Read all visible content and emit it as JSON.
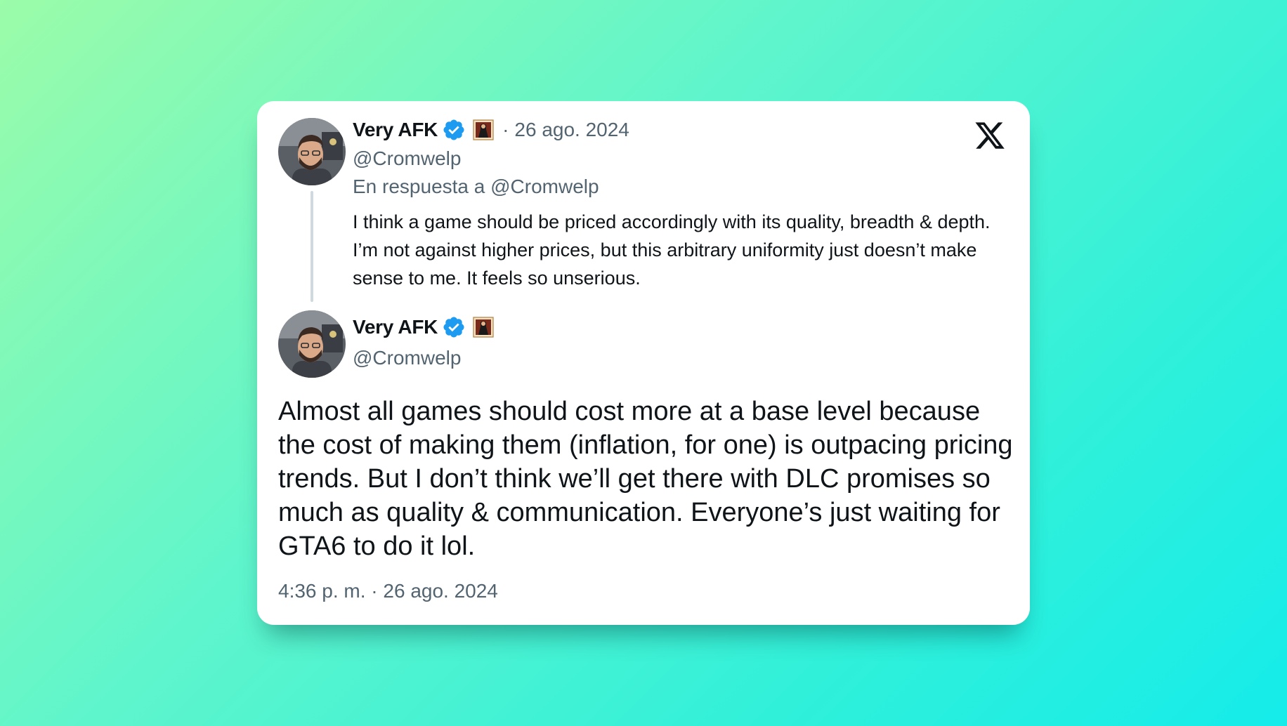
{
  "parent_tweet": {
    "display_name": "Very AFK",
    "handle": "@Cromwelp",
    "separator": "·",
    "date": "26 ago. 2024",
    "reply_context": "En respuesta a @Cromwelp",
    "text": "I think a game should be priced accordingly with its quality, breadth & depth. I’m not against higher prices, but this arbitrary uniformity just doesn’t make sense to me. It feels so unserious.",
    "verified": true,
    "avatar_icon": "avatar-photo-icon",
    "badge_icon": "affiliate-badge-icon"
  },
  "main_tweet": {
    "display_name": "Very AFK",
    "handle": "@Cromwelp",
    "text": "Almost all games should cost more at a base level because the cost of making them (inflation, for one) is outpacing pricing trends. But I don’t think we’ll get there with DLC promises so much as quality & communication. Everyone’s just waiting for GTA6 to do it lol.",
    "timestamp": "4:36 p. m. · 26 ago. 2024",
    "verified": true
  },
  "branding": {
    "logo_icon": "x-logo-icon"
  },
  "colors": {
    "text_primary": "#0f1419",
    "text_secondary": "#536471",
    "verified_blue": "#1d9bf0",
    "thread_line": "#cfd9de",
    "card_background": "#ffffff",
    "background_gradient_start": "#9bfca9",
    "background_gradient_end": "#15ecea"
  }
}
